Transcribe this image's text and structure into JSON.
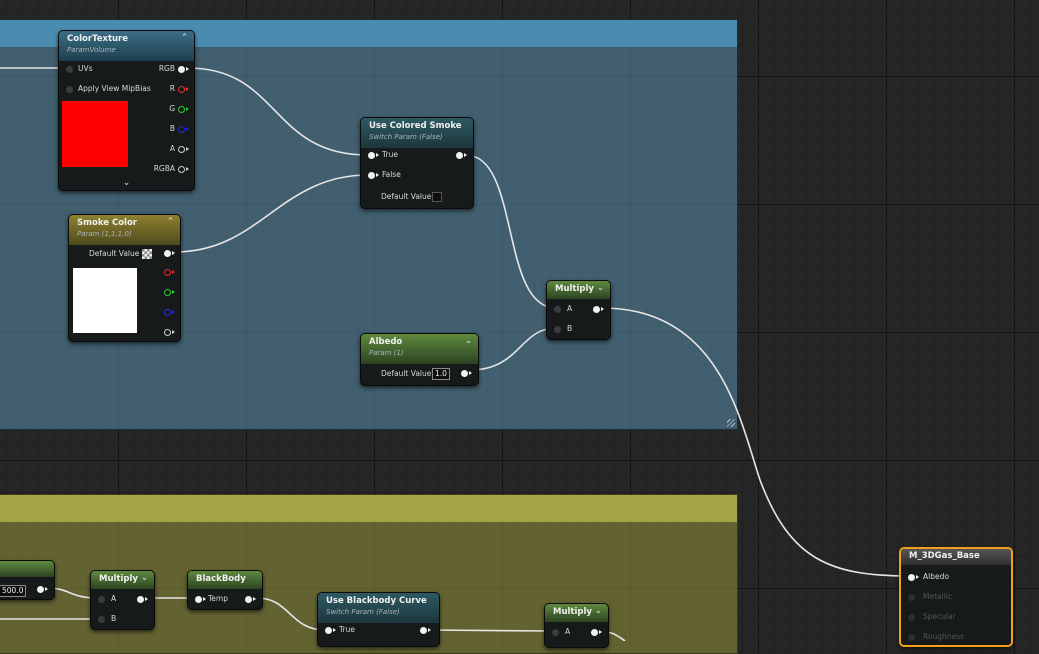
{
  "nodes": {
    "color_texture": {
      "title": "ColorTexture",
      "subtitle": "ParamVolume",
      "inputs": [
        "UVs",
        "Apply View MipBias"
      ],
      "outputs": [
        "RGB",
        "R",
        "G",
        "B",
        "A",
        "RGBA"
      ],
      "preview_color": "#ff0000"
    },
    "smoke_color": {
      "title": "Smoke Color",
      "subtitle": "Param (1,1,1,0)",
      "default_label": "Default Value",
      "preview_color": "#ffffff"
    },
    "use_colored_smoke": {
      "title": "Use Colored Smoke",
      "subtitle": "Switch Param (False)",
      "pins": [
        "True",
        "False"
      ],
      "default_label": "Default Value"
    },
    "albedo": {
      "title": "Albedo",
      "subtitle": "Param (1)",
      "default_label": "Default Value",
      "default_value": "1.0"
    },
    "multiply_top": {
      "title": "Multiply",
      "pins": [
        "A",
        "B"
      ]
    },
    "partial_param": {
      "value": "500.0"
    },
    "multiply_bottom": {
      "title": "Multiply",
      "pins": [
        "A",
        "B"
      ]
    },
    "blackbody": {
      "title": "BlackBody",
      "pin": "Temp"
    },
    "use_blackbody_curve": {
      "title": "Use Blackbody Curve",
      "subtitle": "Switch Param (False)",
      "pin": "True"
    },
    "multiply_right": {
      "title": "Multiply",
      "pin": "A"
    },
    "material_result": {
      "title": "M_3DGas_Base",
      "pins": [
        "Albedo",
        "Metallic",
        "Specular",
        "Roughness"
      ]
    }
  },
  "colors": {
    "comment_blue": "#4a8cb0",
    "comment_olive": "#a5a545",
    "selection": "#f0a01a"
  }
}
